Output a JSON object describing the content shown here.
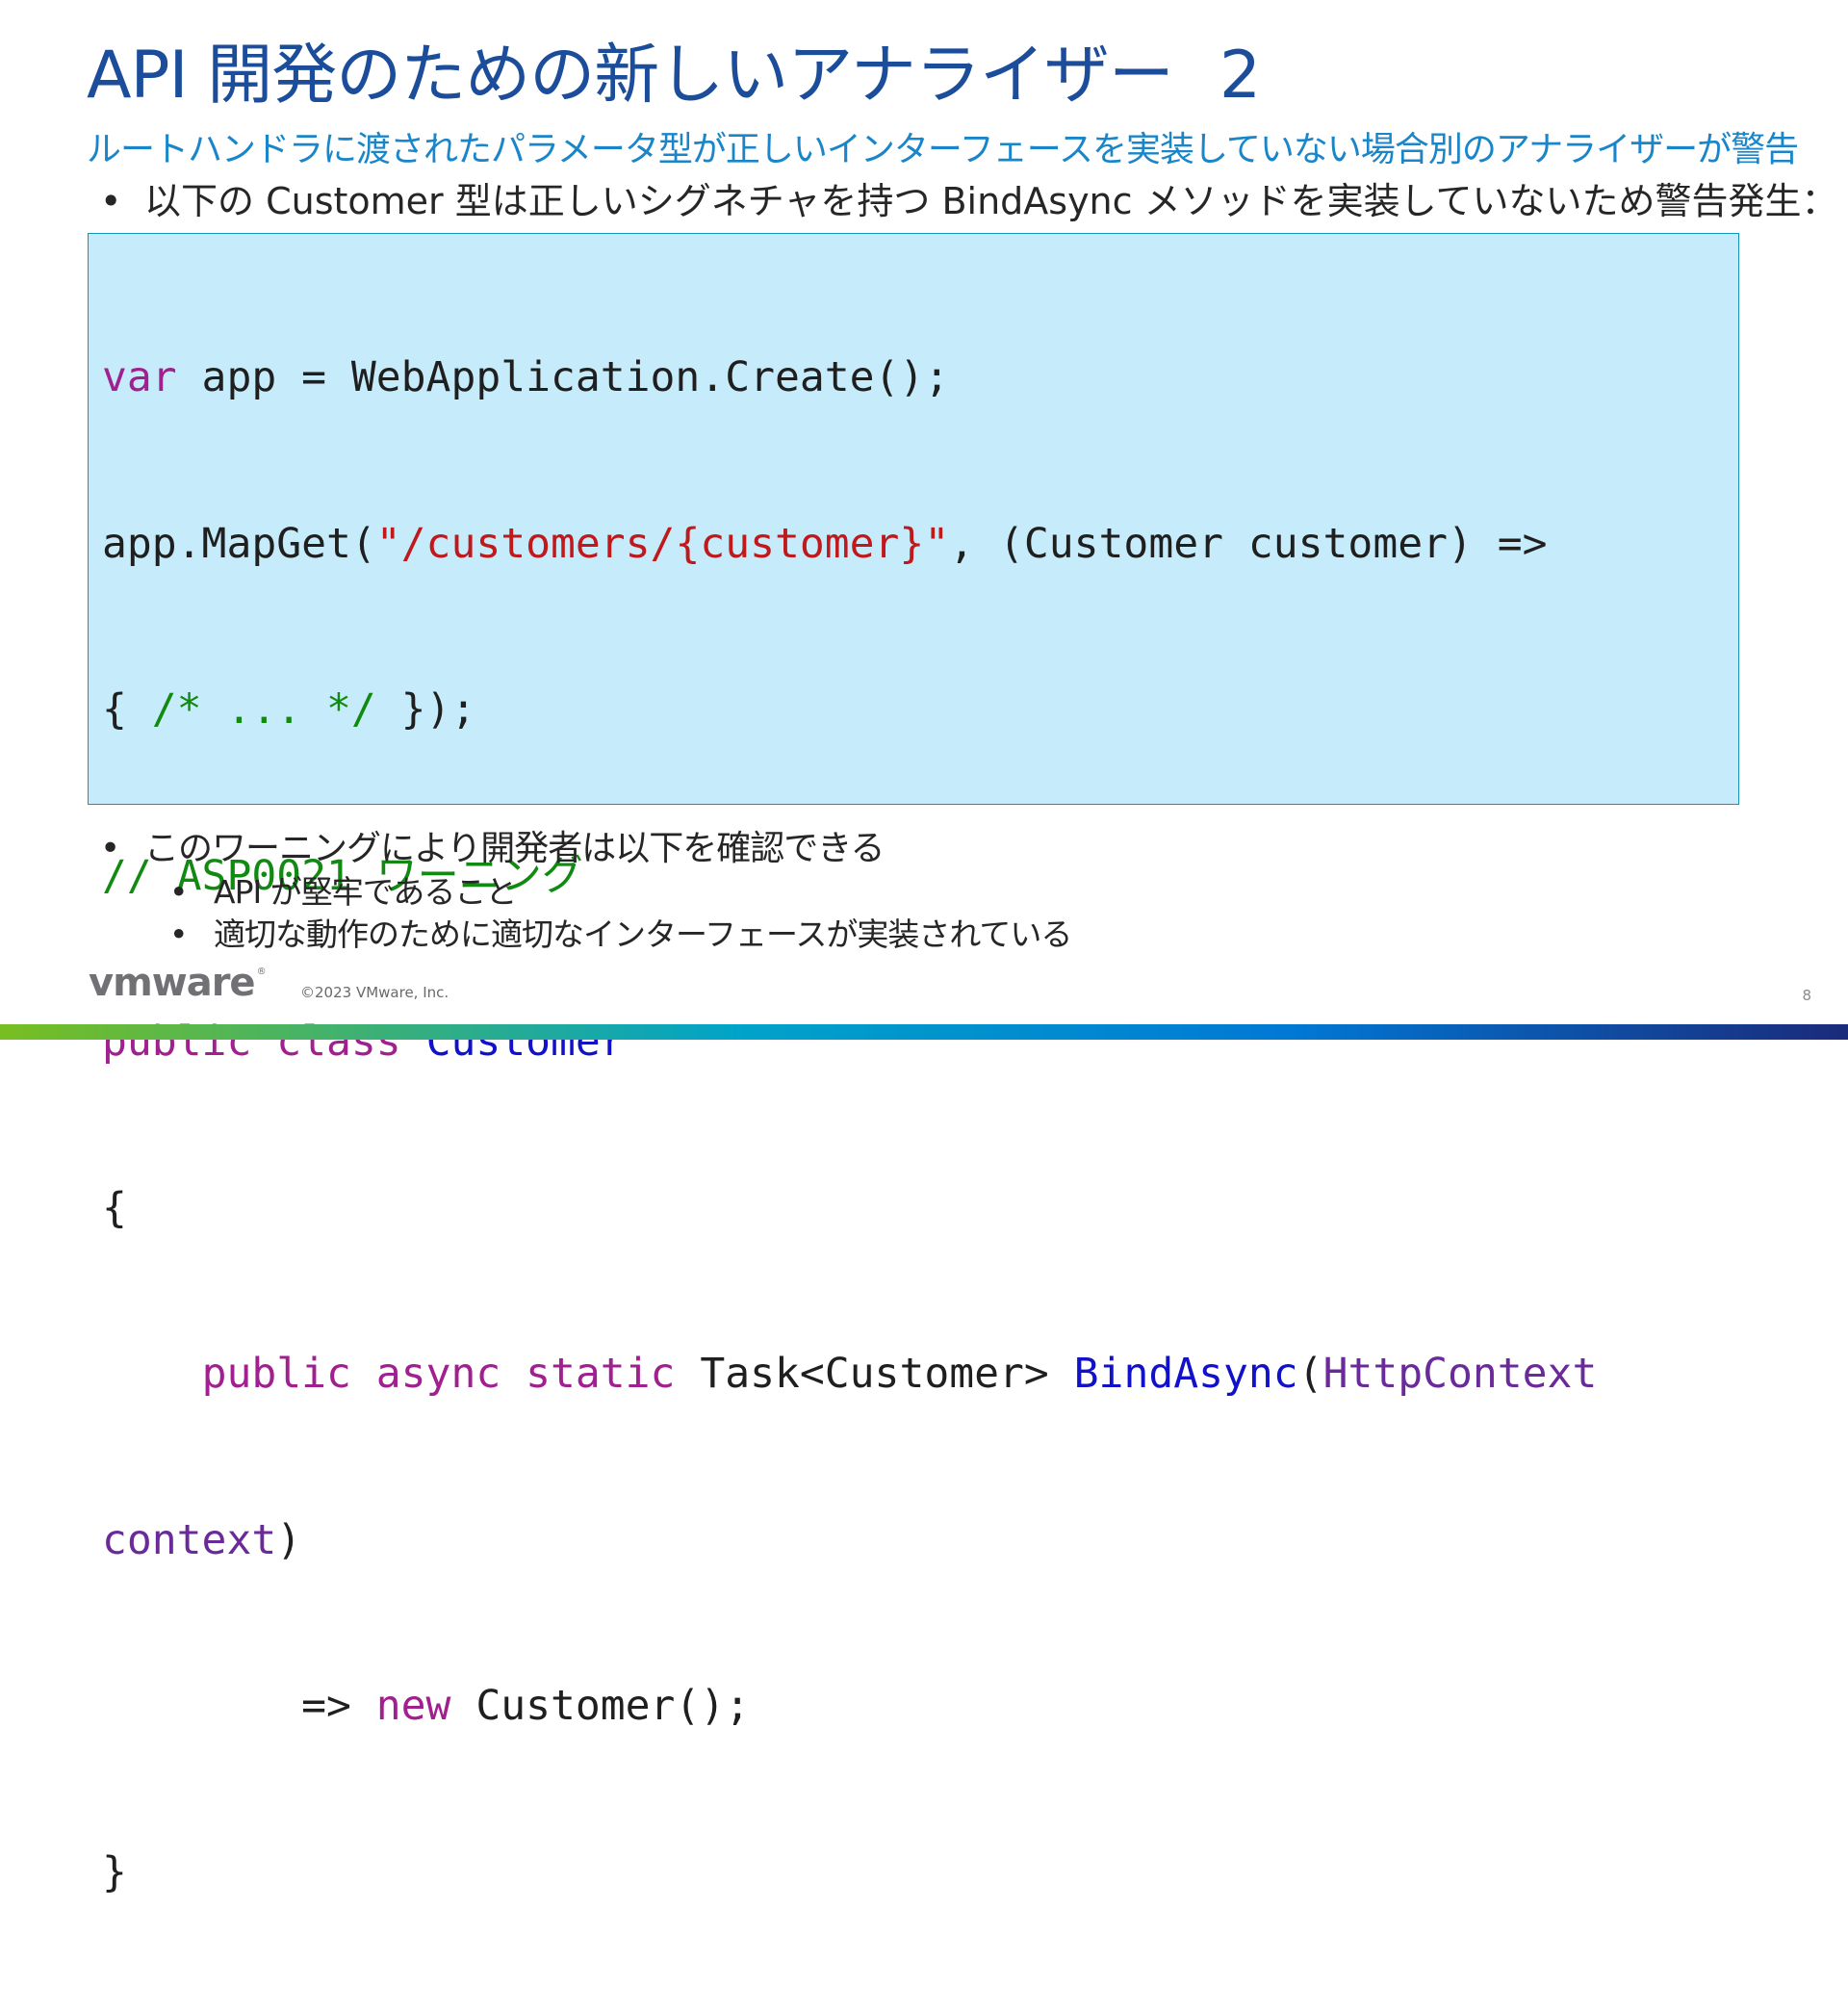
{
  "title": {
    "text": "API 開発のための新しいアナライザー",
    "number": "2"
  },
  "subtitle": "ルートハンドラに渡されたパラメータ型が正しいインターフェースを実装していない場合別のアナライザーが警告",
  "intro_bullet": "以下の Customer 型は正しいシグネチャを持つ BindAsync メソッドを実装していないため警告発生：",
  "code": {
    "l1_kw": "var",
    "l1_rest": " app = WebApplication.Create();",
    "l2_a": "app.MapGet(",
    "l2_str": "\"/customers/{customer}\"",
    "l2_b": ", (Customer customer) =>",
    "l3_a": "{ ",
    "l3_cm": "/* ... */",
    "l3_b": " });",
    "l4_cm": "// ASP0021 ワーニング",
    "l5_kw": "public class",
    "l5_sp": " ",
    "l5_ty": "Customer",
    "l6": "{",
    "l7_indent": "    ",
    "l7_kw": "public async static",
    "l7_a": " Task<Customer> ",
    "l7_ty": "BindAsync",
    "l7_b": "(",
    "l7_pm": "HttpContext",
    "l8_pm": "context",
    "l8_b": ")",
    "l9_indent": "        => ",
    "l9_kw": "new",
    "l9_a": " Customer();",
    "l10": "}"
  },
  "bullets": {
    "main": "このワーニングにより開発者は以下を確認できる",
    "sub": [
      "API が堅牢であること",
      "適切な動作のために適切なインターフェースが実装されている"
    ]
  },
  "bullet_char": "•",
  "footer": {
    "logo": "vmware",
    "logo_mark": "®",
    "copyright": "©2023 VMware, Inc.",
    "page": "8"
  }
}
